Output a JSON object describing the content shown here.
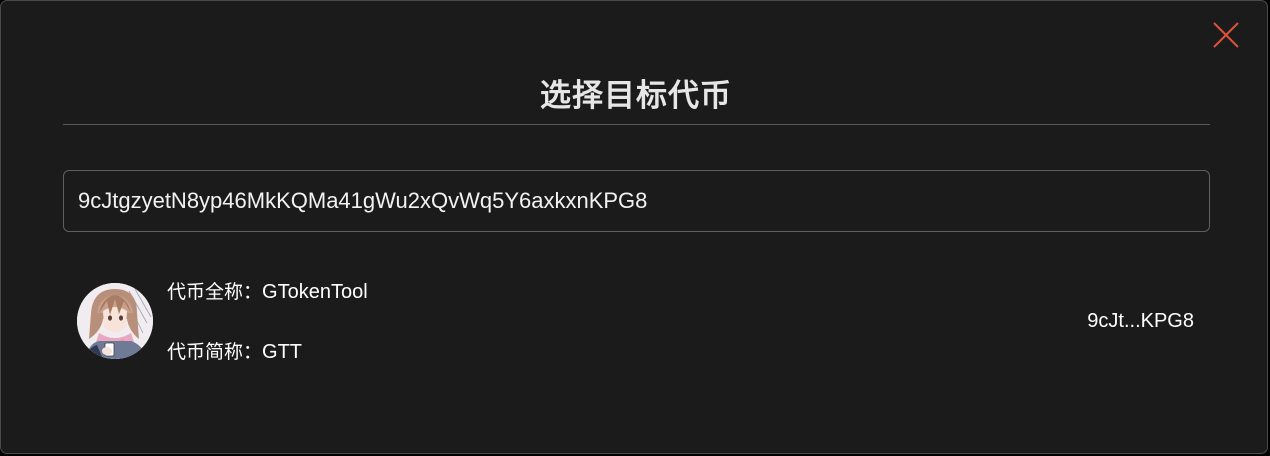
{
  "dialog": {
    "title": "选择目标代币",
    "close_icon": "close-icon",
    "accent_color": "#d9533c"
  },
  "search": {
    "value": "9cJtgzyetN8yp46MkKQMa41gWu2xQvWq5Y6axkxnKPG8"
  },
  "tokens": [
    {
      "avatar_icon": "anime-girl-avatar",
      "full_name_label": "代币全称：",
      "full_name": "GTokenTool",
      "symbol_label": "代币简称：",
      "symbol": "GTT",
      "short_address": "9cJt...KPG8"
    }
  ]
}
